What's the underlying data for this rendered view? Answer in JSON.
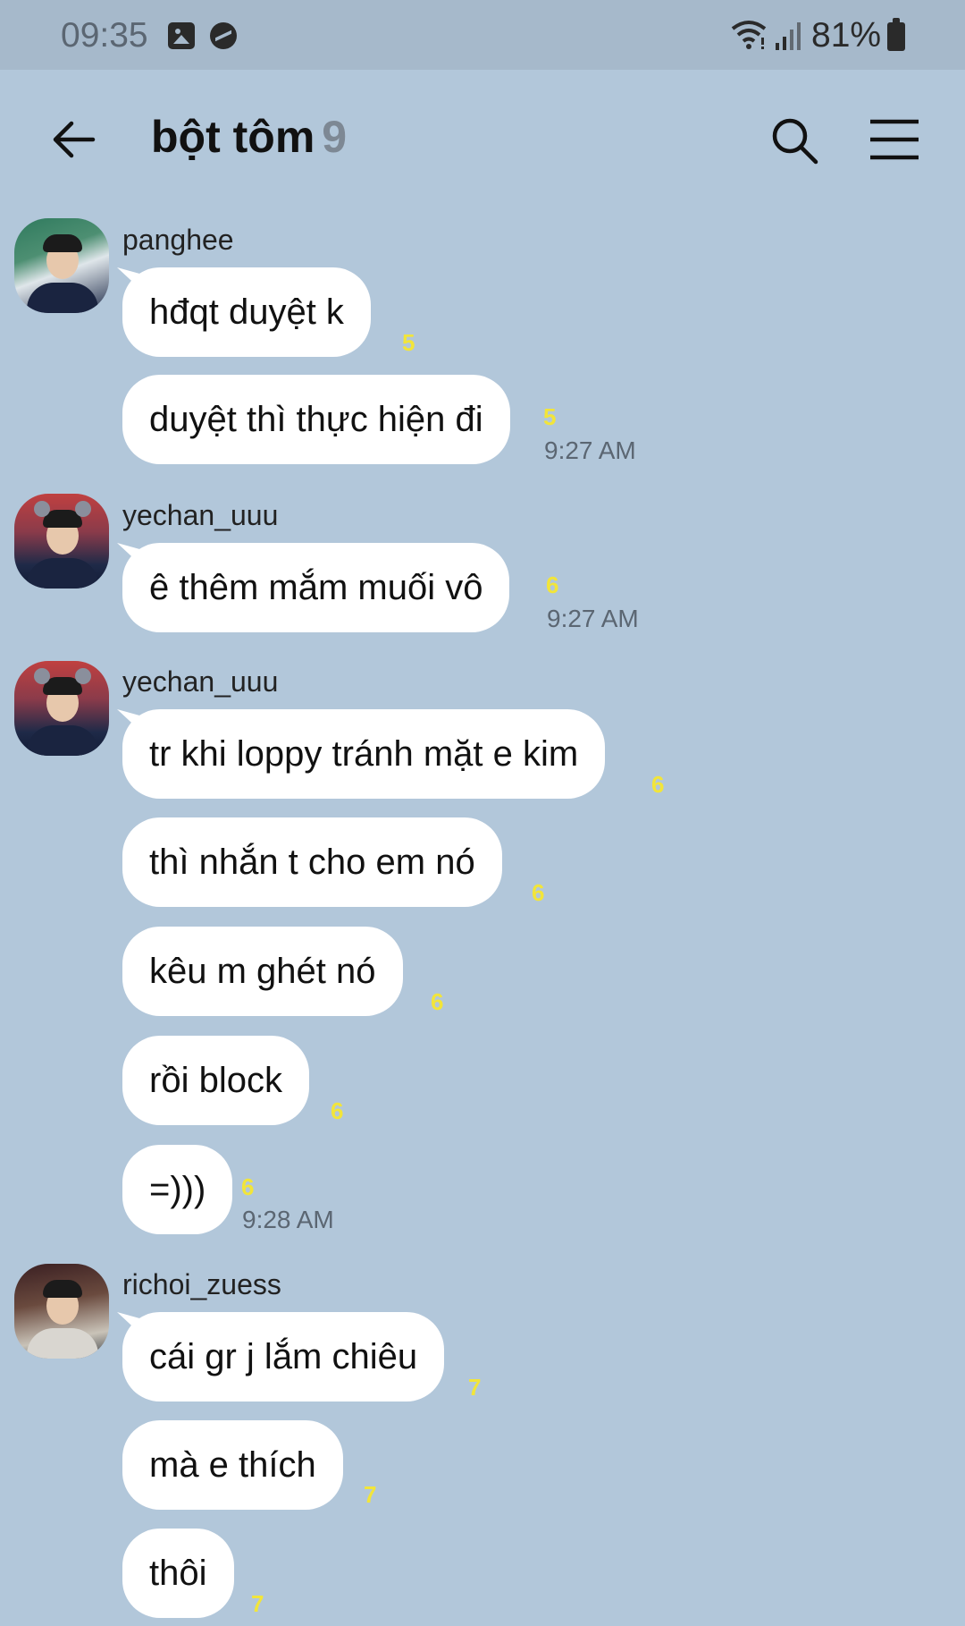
{
  "status_bar": {
    "time": "09:35",
    "battery": "81%",
    "icons": [
      "gallery-icon",
      "messenger-icon",
      "wifi-icon",
      "signal-icon",
      "battery-icon"
    ]
  },
  "header": {
    "title": "bột tôm",
    "member_count": "9",
    "icons": [
      "back-arrow-icon",
      "search-icon",
      "menu-icon"
    ]
  },
  "colors": {
    "background": "#b2c7da",
    "bubble": "#ffffff",
    "unread": "#f2e53a",
    "member_count": "#7d8894"
  },
  "messages": [
    {
      "sender": "panghee",
      "text": "hđqt duyệt k",
      "unread": "5"
    },
    {
      "text": "duyệt thì thực hiện đi",
      "unread": "5",
      "time": "9:27 AM"
    },
    {
      "sender": "yechan_uuu",
      "text": "ê thêm mắm muối vô",
      "unread": "6",
      "time": "9:27 AM"
    },
    {
      "sender": "yechan_uuu",
      "text": "tr khi loppy tránh mặt e kim",
      "unread": "6"
    },
    {
      "text": "thì nhắn t cho em nó",
      "unread": "6"
    },
    {
      "text": "kêu m ghét nó",
      "unread": "6"
    },
    {
      "text": "rồi block",
      "unread": "6"
    },
    {
      "text": "=)))",
      "unread": "6",
      "time": "9:28 AM"
    },
    {
      "sender": "richoi_zuess",
      "text": "cái gr j lắm chiêu",
      "unread": "7"
    },
    {
      "text": "mà e thích",
      "unread": "7"
    },
    {
      "text": "thôi",
      "unread": "7"
    }
  ]
}
